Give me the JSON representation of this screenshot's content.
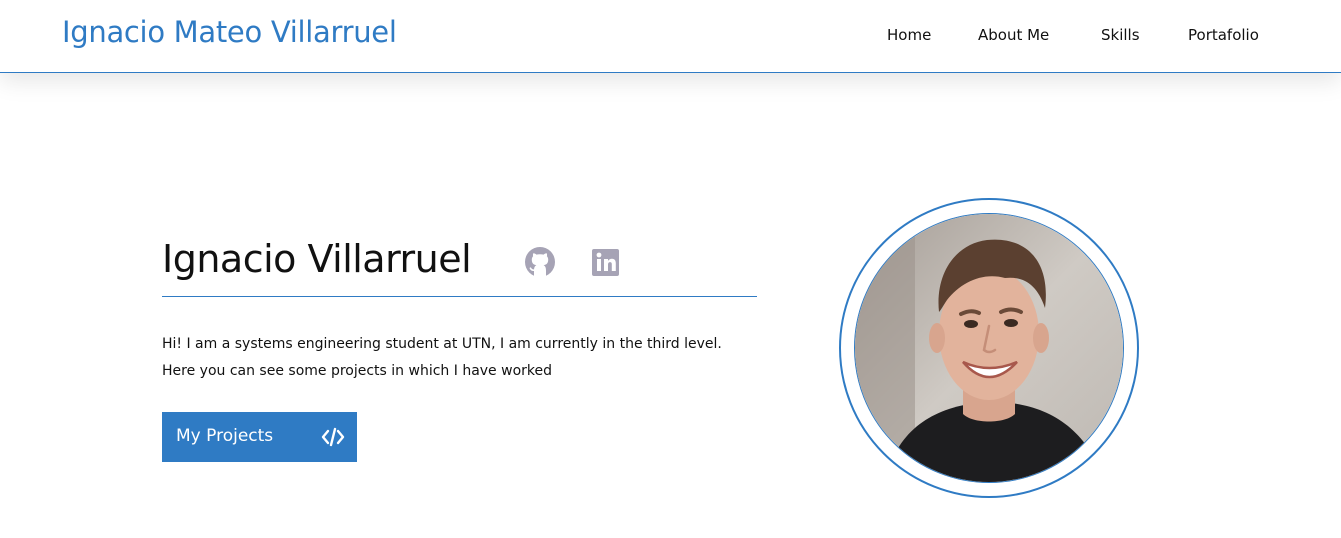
{
  "header": {
    "brand": "Ignacio Mateo Villarruel",
    "nav": [
      "Home",
      "About Me",
      "Skills",
      "Portafolio"
    ]
  },
  "hero": {
    "name": "Ignacio Villarruel",
    "bio_line1": "Hi! I am a systems engineering student at UTN, I am currently in the third level.",
    "bio_line2": "Here you can see some projects in which I have worked",
    "button_label": "My Projects",
    "button_icon": "code-icon",
    "social_icons": [
      "github-icon",
      "linkedin-icon"
    ]
  },
  "colors": {
    "accent": "#2f7bc4",
    "icon_gray": "#a6a3b5",
    "text": "#111111",
    "background": "#ffffff"
  }
}
